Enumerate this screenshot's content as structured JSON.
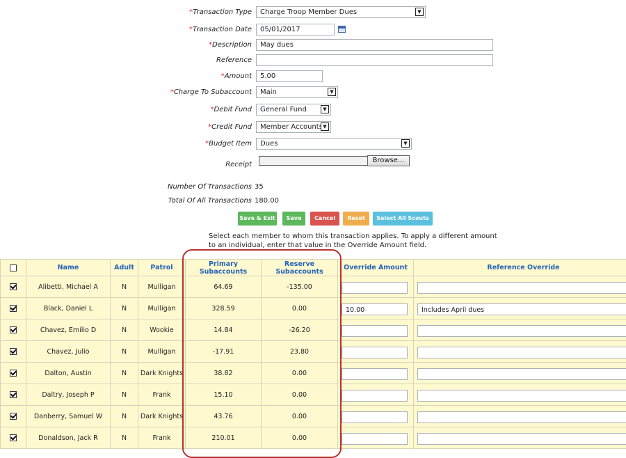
{
  "form": {
    "transaction_type": {
      "label": "Transaction Type",
      "value": "Charge Troop Member Dues"
    },
    "transaction_date": {
      "label": "Transaction Date",
      "value": "05/01/2017"
    },
    "description": {
      "label": "Description",
      "value": "May dues"
    },
    "reference": {
      "label": "Reference",
      "value": ""
    },
    "amount": {
      "label": "Amount",
      "value": "5.00"
    },
    "charge_to_subaccount": {
      "label": "Charge To Subaccount",
      "value": "Main"
    },
    "debit_fund": {
      "label": "Debit Fund",
      "value": "General Fund"
    },
    "credit_fund": {
      "label": "Credit Fund",
      "value": "Member Accounts"
    },
    "budget_item": {
      "label": "Budget Item",
      "value": "Dues"
    },
    "receipt": {
      "label": "Receipt",
      "browse_label": "Browse..."
    },
    "required_marker": "*"
  },
  "stats": {
    "num_transactions_label": "Number Of Transactions",
    "num_transactions_value": "35",
    "total_label": "Total Of All Transactions",
    "total_value": "180.00"
  },
  "buttons": {
    "save_exit": "Save & Exit",
    "save": "Save",
    "cancel": "Cancel",
    "reset": "Reset",
    "select_all": "Select All Scouts"
  },
  "colors": {
    "save_green": "#5cb85c",
    "cancel_red": "#d9534f",
    "reset_orange": "#f0ad4e",
    "select_blue": "#5bc0de",
    "header_blue": "#2463b8",
    "row_yellow": "#fff9cf",
    "highlight_red": "#b8322c"
  },
  "instructions": "Select each member to whom this transaction applies.  To apply a different amount to an individual, enter that value in the Override Amount field.",
  "table": {
    "headers": {
      "name": "Name",
      "adult": "Adult",
      "patrol": "Patrol",
      "primary": "Primary Subaccounts",
      "reserve": "Reserve Subaccounts",
      "override_amount": "Override Amount",
      "reference_override": "Reference Override"
    },
    "rows": [
      {
        "name": "Alibetti, Michael A",
        "adult": "N",
        "patrol": "Mulligan",
        "primary": "64.69",
        "reserve": "-135.00",
        "override_amount": "",
        "reference_override": ""
      },
      {
        "name": "Black, Daniel L",
        "adult": "N",
        "patrol": "Mulligan",
        "primary": "328.59",
        "reserve": "0.00",
        "override_amount": "10.00",
        "reference_override": "Includes April dues"
      },
      {
        "name": "Chavez, Emilio D",
        "adult": "N",
        "patrol": "Wookie",
        "primary": "14.84",
        "reserve": "-26.20",
        "override_amount": "",
        "reference_override": ""
      },
      {
        "name": "Chavez, Julio",
        "adult": "N",
        "patrol": "Mulligan",
        "primary": "-17.91",
        "reserve": "23.80",
        "override_amount": "",
        "reference_override": ""
      },
      {
        "name": "Dalton, Austin",
        "adult": "N",
        "patrol": "Dark Knights",
        "primary": "38.82",
        "reserve": "0.00",
        "override_amount": "",
        "reference_override": ""
      },
      {
        "name": "Daltry, Joseph P",
        "adult": "N",
        "patrol": "Frank",
        "primary": "15.10",
        "reserve": "0.00",
        "override_amount": "",
        "reference_override": ""
      },
      {
        "name": "Danberry, Samuel W",
        "adult": "N",
        "patrol": "Dark Knights",
        "primary": "43.76",
        "reserve": "0.00",
        "override_amount": "",
        "reference_override": ""
      },
      {
        "name": "Donaldson, Jack R",
        "adult": "N",
        "patrol": "Frank",
        "primary": "210.01",
        "reserve": "0.00",
        "override_amount": "",
        "reference_override": ""
      }
    ]
  }
}
